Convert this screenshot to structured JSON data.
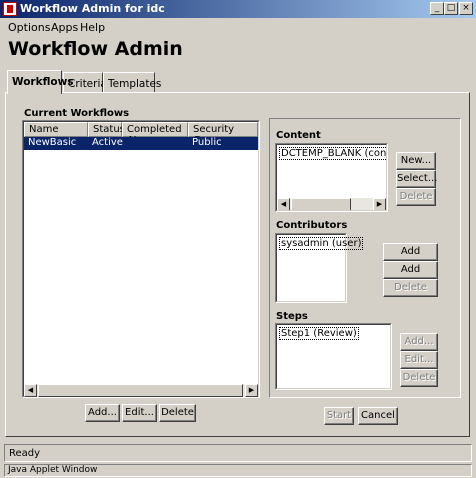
{
  "window": {
    "title": "Workflow Admin for idc"
  },
  "menu": [
    "Options",
    "Apps",
    "Help"
  ],
  "page_title": "Workflow Admin",
  "tabs": [
    "Workflows",
    "Criteria",
    "Templates"
  ],
  "current_workflows": {
    "label": "Current Workflows",
    "columns": [
      "Name",
      "Status",
      "Completed At",
      "Security Group"
    ],
    "rows": [
      {
        "name": "NewBasic",
        "status": "Active",
        "completed_at": "",
        "security_group": "Public"
      }
    ],
    "buttons": {
      "add": "Add...",
      "edit": "Edit...",
      "delete": "Delete"
    }
  },
  "content": {
    "label": "Content",
    "items": [
      "DCTEMP_BLANK (contribu"
    ],
    "buttons": {
      "new": "New...",
      "select": "Select...",
      "delete": "Delete"
    }
  },
  "contributors": {
    "label": "Contributors",
    "items": [
      "sysadmin (user)"
    ],
    "buttons": {
      "add_alias": "Add Alias...",
      "add_user": "Add User...",
      "delete": "Delete"
    }
  },
  "steps": {
    "label": "Steps",
    "items": [
      "Step1 (Review)"
    ],
    "buttons": {
      "add": "Add...",
      "edit": "Edit...",
      "delete": "Delete"
    }
  },
  "actions": {
    "start": "Start",
    "cancel": "Cancel"
  },
  "status": "Ready",
  "footer": "Java Applet Window",
  "colors": {
    "titlebar": "#0a246a",
    "selection": "#0a246a",
    "face": "#d4d0c8"
  }
}
